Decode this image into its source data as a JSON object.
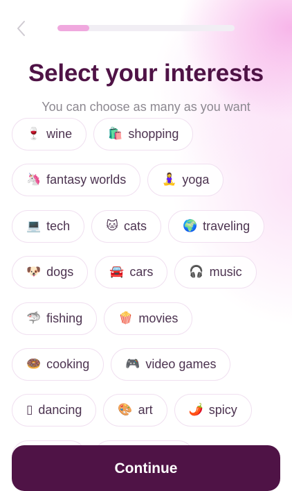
{
  "header": {
    "back_icon": "chevron-left-icon",
    "progress_fraction": 0.18
  },
  "title": "Select your interests",
  "subtitle": "You can choose as many as you want",
  "chip_rows": [
    [
      {
        "emoji": "🍷",
        "label": "wine"
      },
      {
        "emoji": "🛍️",
        "label": "shopping"
      }
    ],
    [
      {
        "emoji": "🦄",
        "label": "fantasy worlds"
      },
      {
        "emoji": "🧘‍♀️",
        "label": "yoga"
      }
    ],
    [
      {
        "emoji": "💻",
        "label": "tech"
      },
      {
        "emoji": "🐱",
        "label": "cats"
      },
      {
        "emoji": "🌍",
        "label": "traveling"
      }
    ],
    [
      {
        "emoji": "🐶",
        "label": "dogs"
      },
      {
        "emoji": "🚘",
        "label": "cars"
      },
      {
        "emoji": "🎧",
        "label": "music"
      }
    ],
    [
      {
        "emoji": "🦈",
        "label": "fishing"
      },
      {
        "emoji": "🍿",
        "label": "movies"
      }
    ],
    [
      {
        "emoji": "🍩",
        "label": "cooking"
      },
      {
        "emoji": "🎮",
        "label": "video games"
      }
    ],
    [
      {
        "emoji": "▯",
        "label": "dancing"
      },
      {
        "emoji": "🎨",
        "label": "art"
      },
      {
        "emoji": "🌶️",
        "label": "spicy"
      }
    ],
    [
      {
        "emoji": "",
        "label": ""
      },
      {
        "emoji": "",
        "label": ""
      }
    ]
  ],
  "continue_label": "Continue",
  "colors": {
    "brand": "#4f1346",
    "progress_fill": "#f0a8de",
    "chip_border": "#f0dff0"
  }
}
